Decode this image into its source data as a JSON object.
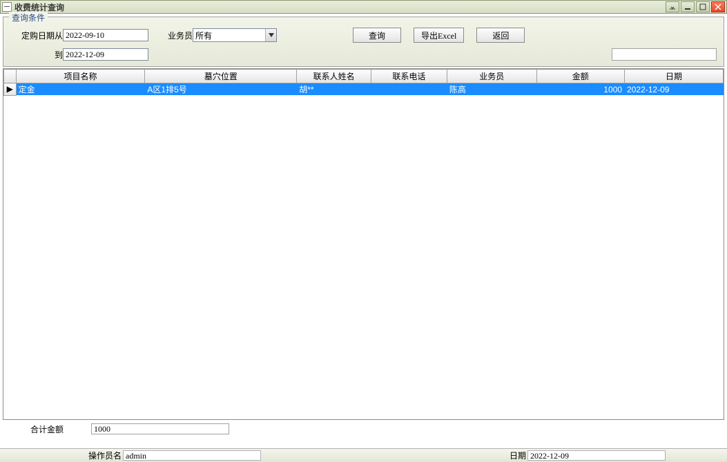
{
  "window": {
    "title": "收费统计查询"
  },
  "query": {
    "legend": "查询条件",
    "date_from_label": "定购日期从",
    "date_from": "2022-09-10",
    "date_to_label": "到",
    "date_to": "2022-12-09",
    "sales_label": "业务员",
    "sales_selected": "所有",
    "btn_query": "查询",
    "btn_export": "导出Excel",
    "btn_back": "返回"
  },
  "table": {
    "headers": {
      "project": "项目名称",
      "position": "墓穴位置",
      "contact_name": "联系人姓名",
      "contact_phone": "联系电话",
      "sales": "业务员",
      "amount": "金额",
      "date": "日期"
    },
    "rows": [
      {
        "project": "定金",
        "position": "A区1排5号",
        "contact_name": "胡**",
        "contact_phone": "",
        "sales": "陈高",
        "amount": "1000",
        "date": "2022-12-09"
      }
    ]
  },
  "summary": {
    "total_label": "合计金额",
    "total_value": "1000"
  },
  "statusbar": {
    "operator_label": "操作员名",
    "operator_value": "admin",
    "date_label": "日期",
    "date_value": "2022-12-09"
  }
}
